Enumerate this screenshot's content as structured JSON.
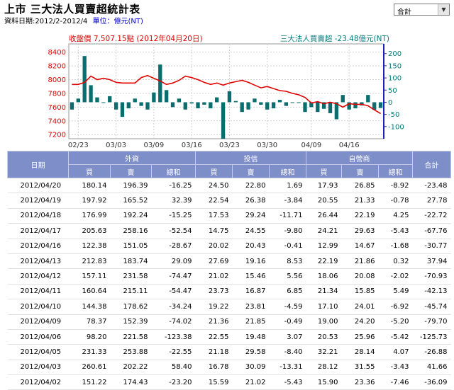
{
  "page": {
    "title": "上市 三大法人買賣超統計表",
    "date_range": "資料日期:2012/2-2012/4",
    "unit": "單位：億元(NT)",
    "select_value": "合計"
  },
  "chart_data": {
    "type": "bar+line",
    "left_caption": "收盤價 7,507.15點 (2012年04月20日)",
    "right_caption": "三大法人買賣超 -23.48億元(NT)",
    "left_axis": {
      "ticks": [
        8400,
        8200,
        8000,
        7800,
        7600,
        7400,
        7200
      ],
      "ylim": [
        7140,
        8520
      ]
    },
    "right_axis": {
      "ticks": [
        200,
        150,
        100,
        50,
        0,
        -50,
        -100
      ],
      "ylim": [
        -150,
        240
      ]
    },
    "x_ticks": [
      "02/23",
      "03/03",
      "03/09",
      "03/16",
      "03/23",
      "03/30",
      "04/09",
      "04/16"
    ],
    "x_tick_index": [
      1,
      7,
      13,
      19,
      25,
      31,
      38,
      44
    ],
    "colors": {
      "price_line": "#e00000",
      "bars": "#0a6e6e",
      "left_text": "#e00000",
      "right_text": "#007a7a"
    },
    "series": [
      {
        "name": "收盤價",
        "kind": "line",
        "values": [
          7930,
          7930,
          7960,
          8050,
          8000,
          8020,
          8000,
          7960,
          7950,
          7950,
          7950,
          8030,
          8060,
          8020,
          7980,
          7930,
          7950,
          7990,
          8050,
          8030,
          8000,
          7960,
          7930,
          7950,
          7920,
          7950,
          7970,
          7990,
          7960,
          7920,
          7880,
          7900,
          7870,
          7840,
          7830,
          7800,
          7780,
          7740,
          7660,
          7680,
          7650,
          7670,
          7650,
          7600,
          7650,
          7640,
          7640,
          7620,
          7560,
          7507
        ]
      },
      {
        "name": "三大法人買賣超",
        "kind": "bar",
        "values": [
          -30,
          15,
          190,
          70,
          20,
          0,
          25,
          -30,
          -60,
          -25,
          15,
          -15,
          -30,
          40,
          155,
          50,
          -20,
          15,
          -30,
          -5,
          -25,
          -10,
          -25,
          20,
          -150,
          45,
          5,
          -40,
          -30,
          15,
          -10,
          -30,
          -25,
          10,
          -15,
          0,
          0,
          -40,
          -20,
          -40,
          -27,
          -45,
          -70,
          30,
          -30,
          -25,
          -13,
          30,
          -31,
          -23.48
        ]
      }
    ]
  },
  "table": {
    "headers": {
      "date": "日期",
      "foreign": "外資",
      "trust": "投信",
      "dealer": "自營商",
      "total": "合計",
      "buy": "買",
      "sell": "賣",
      "net": "總和"
    },
    "rows": [
      [
        "2012/04/20",
        "180.14",
        "196.39",
        "-16.25",
        "24.50",
        "22.80",
        "1.69",
        "17.93",
        "26.85",
        "-8.92",
        "-23.48"
      ],
      [
        "2012/04/19",
        "197.92",
        "165.52",
        "32.39",
        "22.54",
        "26.38",
        "-3.84",
        "20.55",
        "21.33",
        "-0.78",
        "27.78"
      ],
      [
        "2012/04/18",
        "176.99",
        "192.24",
        "-15.25",
        "17.53",
        "29.24",
        "-11.71",
        "26.44",
        "22.19",
        "4.25",
        "-22.72"
      ],
      [
        "2012/04/17",
        "205.63",
        "258.16",
        "-52.54",
        "14.75",
        "24.55",
        "-9.80",
        "24.21",
        "29.63",
        "-5.43",
        "-67.76"
      ],
      [
        "2012/04/16",
        "122.38",
        "151.05",
        "-28.67",
        "20.02",
        "20.43",
        "-0.41",
        "12.99",
        "14.67",
        "-1.68",
        "-30.77"
      ],
      [
        "2012/04/13",
        "212.83",
        "183.74",
        "29.09",
        "27.69",
        "19.16",
        "8.53",
        "22.19",
        "21.86",
        "0.32",
        "37.94"
      ],
      [
        "2012/04/12",
        "157.11",
        "231.58",
        "-74.47",
        "21.02",
        "15.46",
        "5.56",
        "18.06",
        "20.08",
        "-2.02",
        "-70.93"
      ],
      [
        "2012/04/11",
        "160.64",
        "215.11",
        "-54.47",
        "23.73",
        "16.87",
        "6.85",
        "21.34",
        "15.85",
        "5.49",
        "-42.13"
      ],
      [
        "2012/04/10",
        "144.38",
        "178.62",
        "-34.24",
        "19.22",
        "23.81",
        "-4.59",
        "17.10",
        "24.01",
        "-6.92",
        "-45.74"
      ],
      [
        "2012/04/09",
        "78.37",
        "152.39",
        "-74.02",
        "21.36",
        "21.85",
        "-0.49",
        "19.00",
        "24.20",
        "-5.20",
        "-79.70"
      ],
      [
        "2012/04/06",
        "98.20",
        "221.58",
        "-123.38",
        "22.55",
        "19.48",
        "3.07",
        "20.53",
        "25.96",
        "-5.42",
        "-125.73"
      ],
      [
        "2012/04/05",
        "231.33",
        "253.88",
        "-22.55",
        "21.18",
        "29.58",
        "-8.40",
        "32.21",
        "28.14",
        "4.07",
        "-26.88"
      ],
      [
        "2012/04/03",
        "260.61",
        "202.22",
        "58.40",
        "16.78",
        "30.09",
        "-13.31",
        "28.12",
        "31.55",
        "-3.43",
        "41.66"
      ],
      [
        "2012/04/02",
        "151.22",
        "174.43",
        "-23.20",
        "15.59",
        "21.02",
        "-5.43",
        "15.90",
        "23.36",
        "-7.46",
        "-36.09"
      ]
    ]
  }
}
